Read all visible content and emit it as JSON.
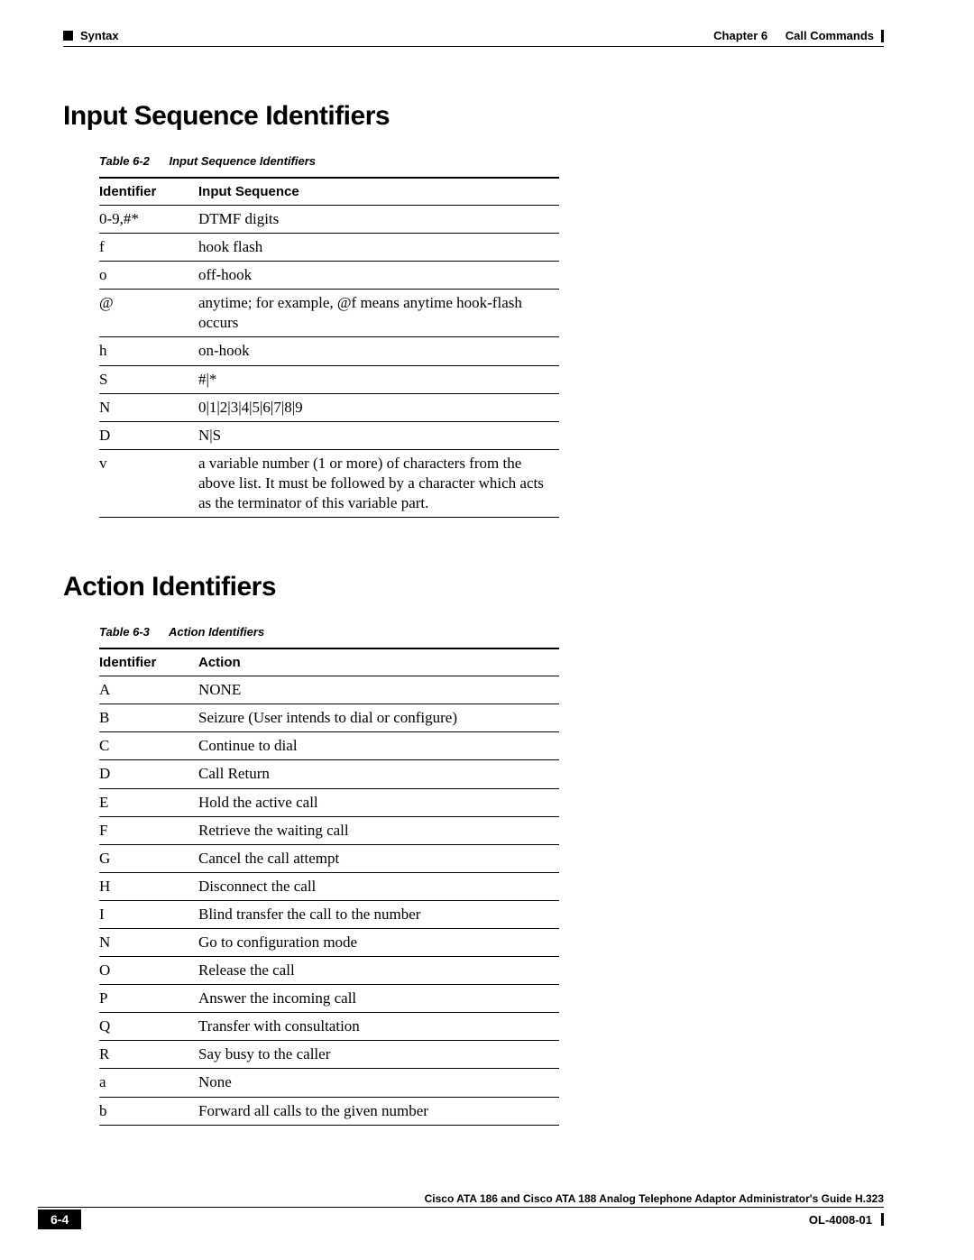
{
  "header": {
    "left_label": "Syntax",
    "right_chapter": "Chapter 6",
    "right_title": "Call Commands"
  },
  "section1": {
    "title": "Input Sequence Identifiers",
    "table_caption_label": "Table 6-2",
    "table_caption_title": "Input Sequence Identifiers",
    "col1": "Identifier",
    "col2": "Input Sequence",
    "rows": [
      {
        "id": "0-9,#*",
        "val": "DTMF digits"
      },
      {
        "id": "f",
        "val": "hook flash"
      },
      {
        "id": "o",
        "val": "off-hook"
      },
      {
        "id": "@",
        "val": "anytime; for example, @f means anytime hook-flash occurs"
      },
      {
        "id": "h",
        "val": "on-hook"
      },
      {
        "id": "S",
        "val": "#|*"
      },
      {
        "id": "N",
        "val": "0|1|2|3|4|5|6|7|8|9"
      },
      {
        "id": "D",
        "val": "N|S"
      },
      {
        "id": "v",
        "val": "a variable number (1 or more) of characters from the above list. It must be followed by a character which acts as the terminator of this variable part."
      }
    ]
  },
  "section2": {
    "title": "Action Identifiers",
    "table_caption_label": "Table 6-3",
    "table_caption_title": "Action Identifiers",
    "col1": "Identifier",
    "col2": "Action",
    "rows": [
      {
        "id": "A",
        "val": "NONE"
      },
      {
        "id": "B",
        "val": "Seizure (User intends to dial or configure)"
      },
      {
        "id": "C",
        "val": "Continue to dial"
      },
      {
        "id": "D",
        "val": "Call Return"
      },
      {
        "id": "E",
        "val": "Hold the active call"
      },
      {
        "id": "F",
        "val": "Retrieve the waiting call"
      },
      {
        "id": "G",
        "val": "Cancel the call attempt"
      },
      {
        "id": "H",
        "val": "Disconnect the call"
      },
      {
        "id": "I",
        "val": "Blind transfer the call to the number"
      },
      {
        "id": "N",
        "val": "Go to configuration mode"
      },
      {
        "id": "O",
        "val": "Release the call"
      },
      {
        "id": "P",
        "val": "Answer the incoming call"
      },
      {
        "id": "Q",
        "val": "Transfer with consultation"
      },
      {
        "id": "R",
        "val": "Say busy to the caller"
      },
      {
        "id": "a",
        "val": "None"
      },
      {
        "id": "b",
        "val": "Forward all calls to the given number"
      }
    ]
  },
  "footer": {
    "book_title": "Cisco ATA 186 and Cisco ATA 188 Analog Telephone Adaptor Administrator's Guide H.323",
    "page_number": "6-4",
    "doc_id": "OL-4008-01"
  }
}
